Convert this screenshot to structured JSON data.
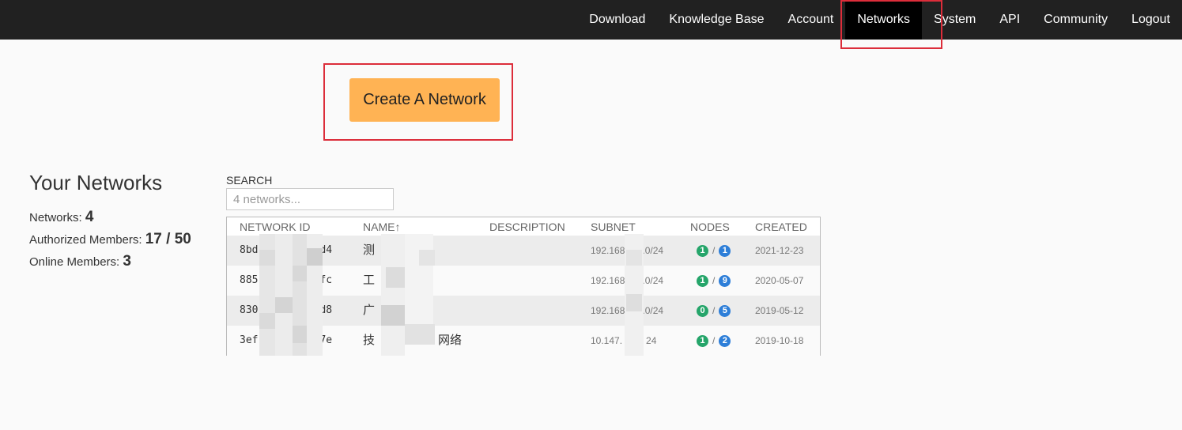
{
  "nav": {
    "items": [
      "Download",
      "Knowledge Base",
      "Account",
      "Networks",
      "System",
      "API",
      "Community",
      "Logout"
    ],
    "active": "Networks"
  },
  "create_button": "Create A Network",
  "stats": {
    "title": "Your Networks",
    "networks_label": "Networks:",
    "networks_value": "4",
    "authorized_label": "Authorized Members:",
    "authorized_value": "17 / 50",
    "online_label": "Online Members:",
    "online_value": "3"
  },
  "search": {
    "label": "SEARCH",
    "placeholder": "4 networks..."
  },
  "table": {
    "headers": {
      "network_id": "NETWORK ID",
      "name": "NAME↑",
      "description": "DESCRIPTION",
      "subnet": "SUBNET",
      "nodes": "NODES",
      "created": "CREATED"
    },
    "rows": [
      {
        "id_start": "8bd",
        "id_end": "d4",
        "name": "测",
        "name_end": "",
        "subnet_start": "192.168",
        "subnet_end": ".0/24",
        "online": "1",
        "total": "1",
        "created": "2021-12-23"
      },
      {
        "id_start": "885",
        "id_end": "fc",
        "name": "工",
        "name_end": "",
        "subnet_start": "192.168",
        "subnet_end": ".0/24",
        "online": "1",
        "total": "9",
        "created": "2020-05-07"
      },
      {
        "id_start": "830",
        "id_end": "d8",
        "name": "广",
        "name_end": "",
        "subnet_start": "192.168",
        "subnet_end": ".0/24",
        "online": "0",
        "total": "5",
        "created": "2019-05-12"
      },
      {
        "id_start": "3ef",
        "id_end": "7e",
        "name": "技",
        "name_end": "网络",
        "subnet_start": "10.147.",
        "subnet_end": "24",
        "online": "1",
        "total": "2",
        "created": "2019-10-18"
      }
    ],
    "node_separator": "/"
  },
  "colors": {
    "topbar": "#212121",
    "active_nav": "#000000",
    "create_button": "#ffb354",
    "highlight_box": "#dc2d3a",
    "online_badge": "#25a56a",
    "total_badge": "#2d7ed8"
  }
}
